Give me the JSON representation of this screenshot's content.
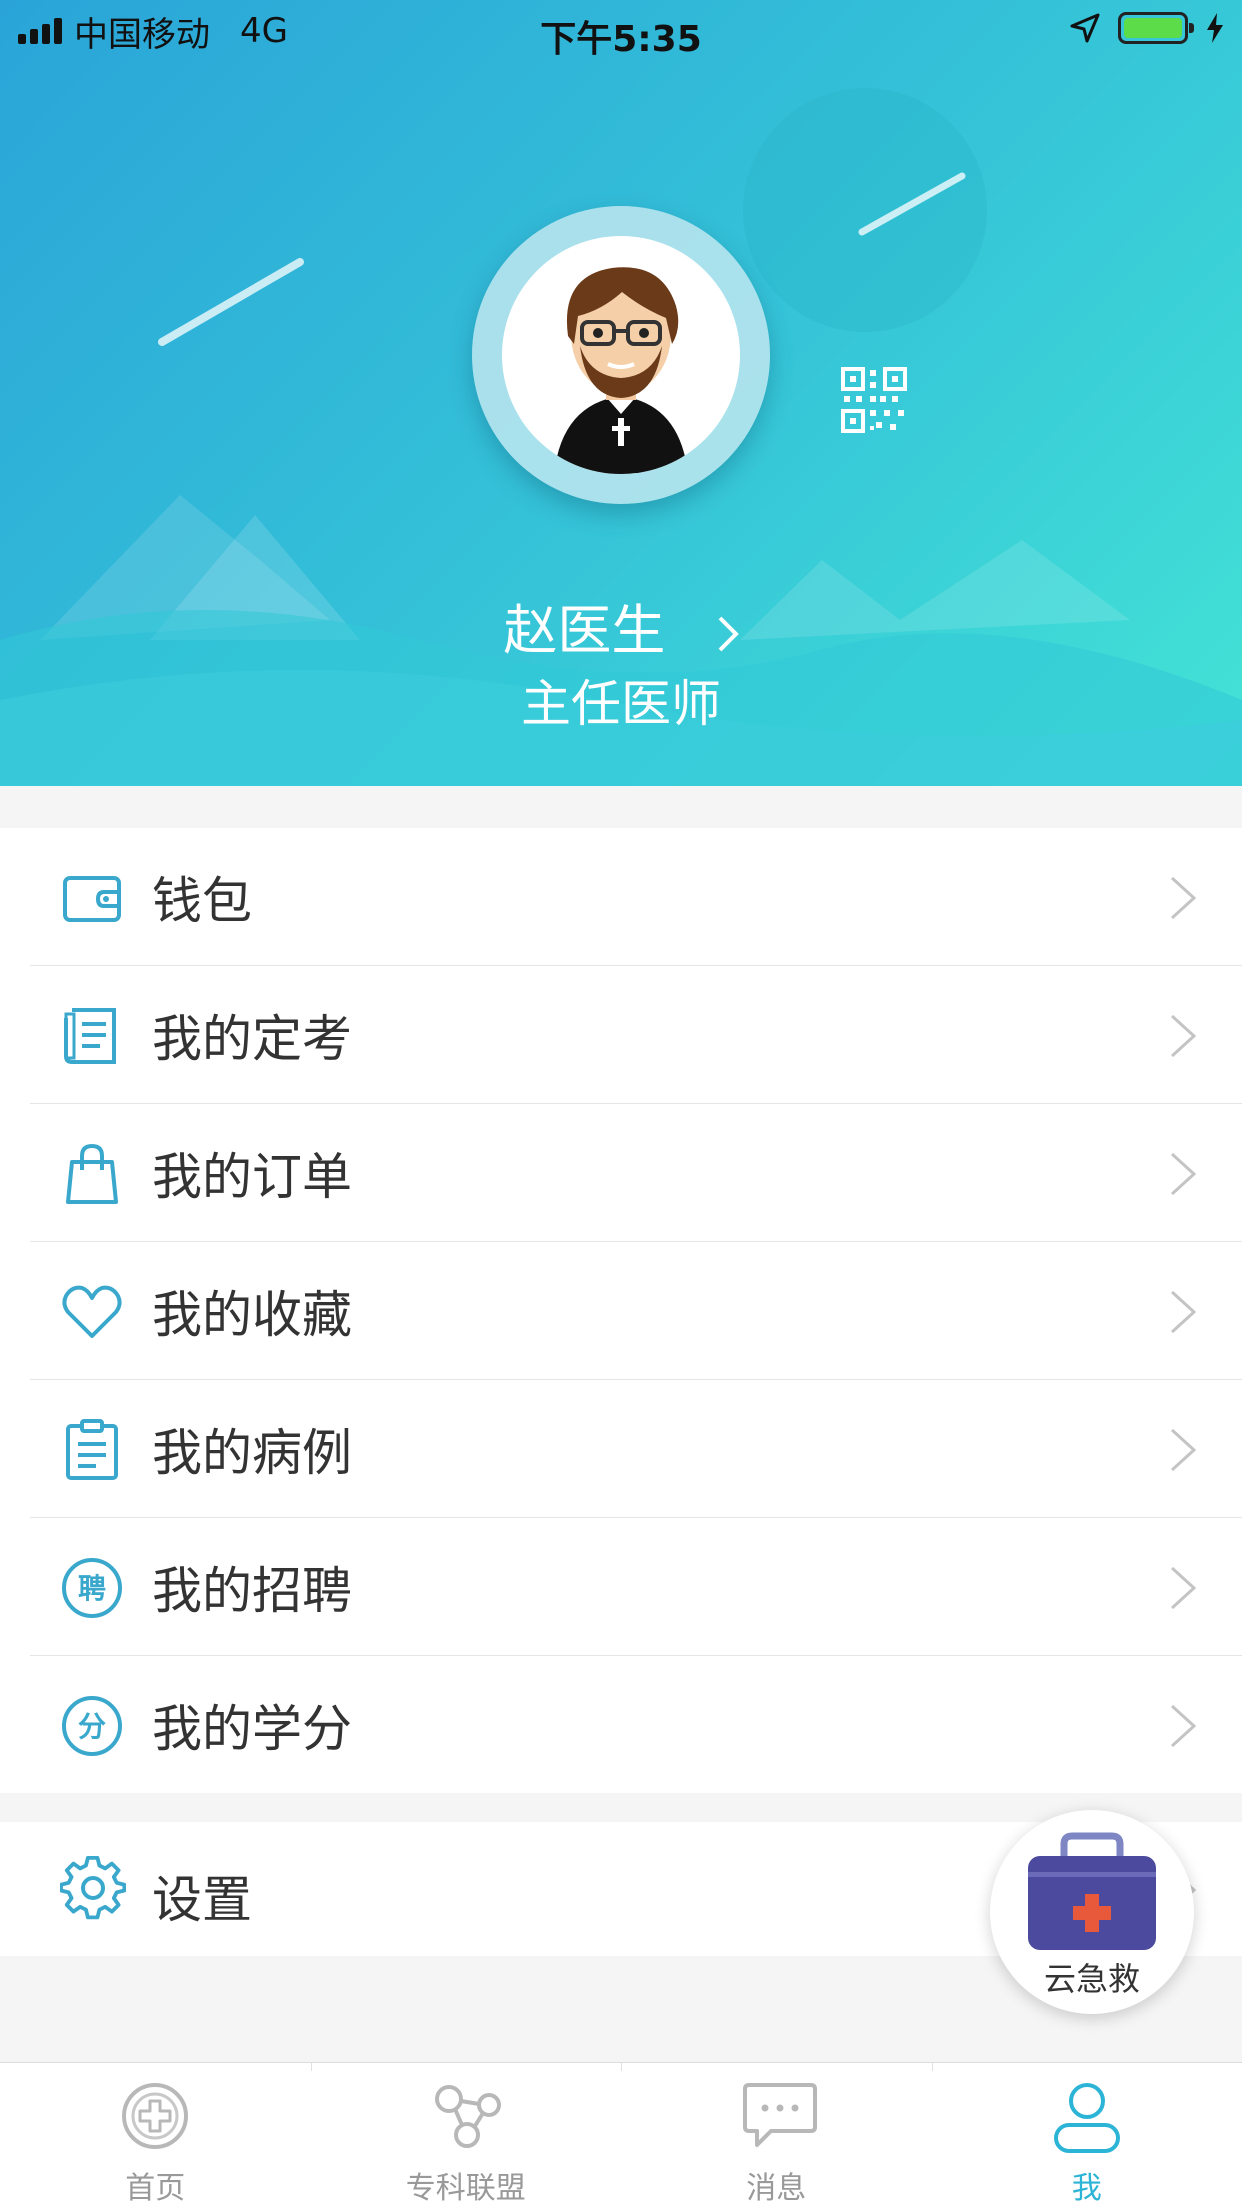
{
  "status_bar": {
    "carrier": "中国移动",
    "network": "4G",
    "time": "下午5:35"
  },
  "profile": {
    "name": "赵医生",
    "title": "主任医师"
  },
  "menu": {
    "items": [
      {
        "label": "钱包",
        "icon": "wallet-icon"
      },
      {
        "label": "我的定考",
        "icon": "exam-document-icon"
      },
      {
        "label": "我的订单",
        "icon": "shopping-bag-icon"
      },
      {
        "label": "我的收藏",
        "icon": "heart-icon"
      },
      {
        "label": "我的病例",
        "icon": "clipboard-icon"
      },
      {
        "label": "我的招聘",
        "icon": "recruit-badge-icon"
      },
      {
        "label": "我的学分",
        "icon": "credit-badge-icon"
      }
    ],
    "recruit_badge_char": "聘",
    "credit_badge_char": "分"
  },
  "settings": {
    "label": "设置",
    "icon": "gear-icon"
  },
  "fab": {
    "label": "云急救",
    "icon": "first-aid-kit-icon"
  },
  "tabbar": {
    "tabs": [
      {
        "label": "首页",
        "icon": "home-cross-icon",
        "active": false
      },
      {
        "label": "专科联盟",
        "icon": "network-icon",
        "active": false
      },
      {
        "label": "消息",
        "icon": "chat-bubble-icon",
        "active": false
      },
      {
        "label": "我",
        "icon": "person-icon",
        "active": true
      }
    ]
  },
  "colors": {
    "accent": "#2cb4d6",
    "icon": "#3aa8cc",
    "header_start": "#2aa4d8",
    "header_end": "#43e3d6",
    "fab_kit": "#4b4a9e",
    "fab_cross": "#e8583a"
  }
}
